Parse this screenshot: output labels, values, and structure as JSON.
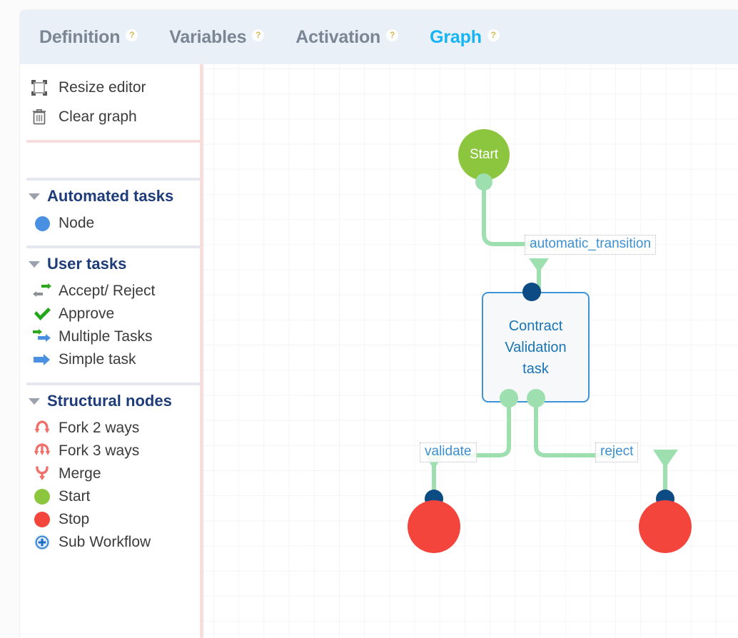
{
  "tabs": [
    {
      "label": "Definition",
      "help": "?",
      "active": false
    },
    {
      "label": "Variables",
      "help": "?",
      "active": false
    },
    {
      "label": "Activation",
      "help": "?",
      "active": false
    },
    {
      "label": "Graph",
      "help": "?",
      "active": true
    }
  ],
  "sidebar": {
    "tools": [
      {
        "label": "Resize editor",
        "icon": "resize-icon"
      },
      {
        "label": "Clear graph",
        "icon": "trash-icon"
      }
    ],
    "sections": [
      {
        "title": "Automated tasks",
        "items": [
          {
            "label": "Node",
            "icon": "blue-circle-icon"
          }
        ]
      },
      {
        "title": "User tasks",
        "items": [
          {
            "label": "Accept/ Reject",
            "icon": "accept-reject-arrows-icon"
          },
          {
            "label": "Approve",
            "icon": "green-check-icon"
          },
          {
            "label": "Multiple Tasks",
            "icon": "multiple-arrows-icon"
          },
          {
            "label": "Simple task",
            "icon": "blue-arrow-icon"
          }
        ]
      },
      {
        "title": "Structural nodes",
        "items": [
          {
            "label": "Fork 2 ways",
            "icon": "fork-2-icon"
          },
          {
            "label": "Fork 3 ways",
            "icon": "fork-3-icon"
          },
          {
            "label": "Merge",
            "icon": "merge-icon"
          },
          {
            "label": "Start",
            "icon": "green-circle-icon"
          },
          {
            "label": "Stop",
            "icon": "red-circle-icon"
          },
          {
            "label": "Sub Workflow",
            "icon": "sub-workflow-plus-icon"
          }
        ]
      }
    ]
  },
  "graph": {
    "nodes": [
      {
        "id": "start",
        "type": "start",
        "label": "Start"
      },
      {
        "id": "contract",
        "type": "task",
        "label": "Contract\nValidation\ntask"
      },
      {
        "id": "stop1",
        "type": "stop",
        "label": ""
      },
      {
        "id": "stop2",
        "type": "stop",
        "label": ""
      }
    ],
    "edges": [
      {
        "from": "start",
        "to": "contract",
        "label": "automatic_transition"
      },
      {
        "from": "contract",
        "to": "stop1",
        "label": "validate"
      },
      {
        "from": "contract",
        "to": "stop2",
        "label": "reject"
      }
    ]
  },
  "colors": {
    "accent": "#17b4f5",
    "section_title": "#1f3c7a",
    "tab_inactive": "#7a8694",
    "start_node": "#8cc63e",
    "stop_node": "#f4453d",
    "task_border": "#3f93d4",
    "task_text": "#1874b4",
    "edge": "#9ddfae",
    "port_navy": "#0d4b84",
    "divider_pink": "#f7dedd",
    "divider_gray": "#e6e8ef",
    "header_bg": "#e9f0f8"
  }
}
